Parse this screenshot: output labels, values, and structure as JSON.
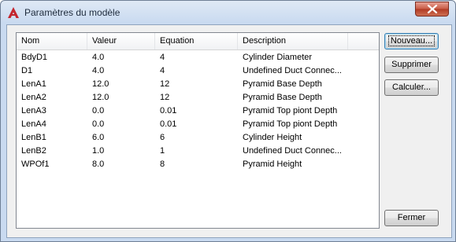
{
  "window": {
    "title": "Paramètres du modèle",
    "close_label": "×"
  },
  "table": {
    "columns": [
      "Nom",
      "Valeur",
      "Equation",
      "Description"
    ],
    "rows": [
      [
        "BdyD1",
        "4.0",
        "4",
        "Cylinder Diameter"
      ],
      [
        "D1",
        "4.0",
        "4",
        "Undefined Duct Connec..."
      ],
      [
        "LenA1",
        "12.0",
        "12",
        "Pyramid Base Depth"
      ],
      [
        "LenA2",
        "12.0",
        "12",
        "Pyramid Base Depth"
      ],
      [
        "LenA3",
        "0.0",
        "0.01",
        "Pyramid Top piont Depth"
      ],
      [
        "LenA4",
        "0.0",
        "0.01",
        "Pyramid Top piont Depth"
      ],
      [
        "LenB1",
        "6.0",
        "6",
        "Cylinder Height"
      ],
      [
        "LenB2",
        "1.0",
        "1",
        "Undefined Duct Connec..."
      ],
      [
        "WPOf1",
        "8.0",
        "8",
        "Pyramid Height"
      ]
    ]
  },
  "buttons": {
    "new": "Nouveau...",
    "delete": "Supprimer",
    "calculate": "Calculer...",
    "close": "Fermer"
  },
  "colors": {
    "app_icon": "#c4262e",
    "close_button": "#c75a44"
  }
}
